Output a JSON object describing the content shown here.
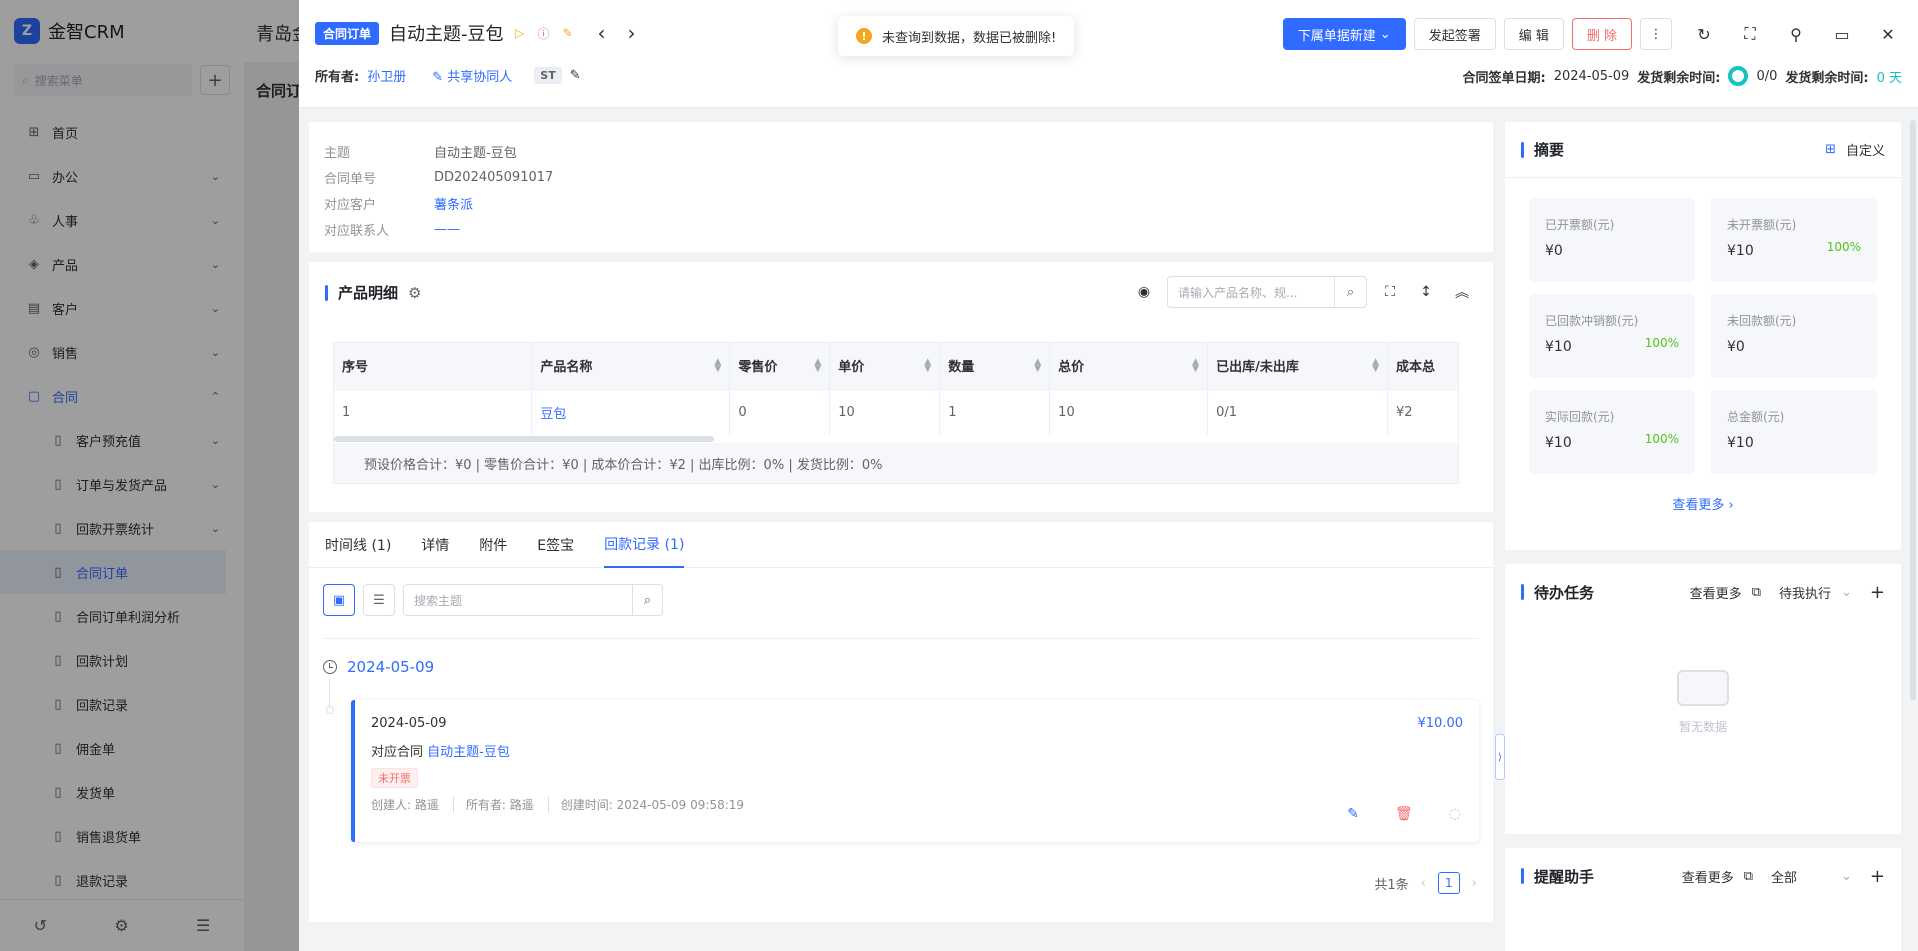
{
  "app": {
    "name": "金智CRM",
    "company": "青岛金",
    "bg_tab": "合同订",
    "search_placeholder": "搜索菜单",
    "menu": [
      {
        "label": "首页",
        "icon": "home-icon",
        "glyph": "⊞",
        "chev": ""
      },
      {
        "label": "办公",
        "icon": "office-icon",
        "glyph": "▭",
        "chev": "⌄"
      },
      {
        "label": "人事",
        "icon": "people-icon",
        "glyph": "♧",
        "chev": "⌄"
      },
      {
        "label": "产品",
        "icon": "product-icon",
        "glyph": "◈",
        "chev": "⌄"
      },
      {
        "label": "客户",
        "icon": "customer-icon",
        "glyph": "▤",
        "chev": "⌄"
      },
      {
        "label": "销售",
        "icon": "sales-icon",
        "glyph": "◎",
        "chev": "⌄"
      },
      {
        "label": "合同",
        "icon": "contract-icon",
        "glyph": "▢",
        "chev": "⌃"
      }
    ],
    "submenu": [
      {
        "label": "客户预充值",
        "chev": "⌄"
      },
      {
        "label": "订单与发货产品",
        "chev": "⌄"
      },
      {
        "label": "回款开票统计",
        "chev": "⌄"
      },
      {
        "label": "合同订单",
        "chev": ""
      },
      {
        "label": "合同订单利润分析",
        "chev": ""
      },
      {
        "label": "回款计划",
        "chev": ""
      },
      {
        "label": "回款记录",
        "chev": ""
      },
      {
        "label": "佣金单",
        "chev": ""
      },
      {
        "label": "发货单",
        "chev": ""
      },
      {
        "label": "销售退货单",
        "chev": ""
      },
      {
        "label": "退款记录",
        "chev": ""
      }
    ]
  },
  "toast": {
    "message": "未查询到数据，数据已被删除!"
  },
  "header": {
    "type_badge": "合同订单",
    "title": "自动主题-豆包",
    "owner_label": "所有者:",
    "owner_name": "孙卫册",
    "share_label": "共享协同人",
    "st_tag": "ST",
    "actions": {
      "new_sub": "下属单据新建",
      "sign": "发起签署",
      "edit": "编 辑",
      "delete": "删 除"
    },
    "sign_date_label": "合同签单日期:",
    "sign_date": "2024-05-09",
    "ship_remain_label": "发货剩余时间:",
    "ship_ratio": "0/0",
    "ship_remain_label2": "发货剩余时间:",
    "ship_days": "0 天"
  },
  "basic": {
    "fields": [
      {
        "label": "主题",
        "value": "自动主题-豆包",
        "link": false
      },
      {
        "label": "合同单号",
        "value": "DD202405091017",
        "link": false
      },
      {
        "label": "对应客户",
        "value": "薯条派",
        "link": true
      },
      {
        "label": "对应联系人",
        "value": "——",
        "link": true
      }
    ]
  },
  "products": {
    "title": "产品明细",
    "search_placeholder": "请输入产品名称、规...",
    "columns": [
      "序号",
      "产品名称",
      "零售价",
      "单价",
      "数量",
      "总价",
      "已出库/未出库",
      "成本总"
    ],
    "rows": [
      [
        "1",
        "豆包",
        "0",
        "10",
        "1",
        "10",
        "0/1",
        "¥2"
      ]
    ],
    "summary": "预设价格合计：¥0 |    零售价合计：¥0 |    成本价合计：¥2 |    出库比例：0% |    发货比例：0%"
  },
  "records": {
    "tabs": [
      "时间线 (1)",
      "详情",
      "附件",
      "E签宝",
      "回款记录 (1)"
    ],
    "active_tab": 4,
    "search_placeholder": "搜索主题",
    "group_date": "2024-05-09",
    "card": {
      "date": "2024-05-09",
      "amount": "¥10.00",
      "contract_label": "对应合同",
      "contract_link": "自动主题-豆包",
      "status": "未开票",
      "creator": "创建人: 路遥",
      "owner": "所有者: 路遥",
      "created_at": "创建时间: 2024-05-09 09:58:19"
    },
    "pager": {
      "total": "共1条",
      "page": "1"
    }
  },
  "summary_panel": {
    "title": "摘要",
    "customize": "自定义",
    "stats": [
      {
        "label": "已开票额(元)",
        "value": "¥0",
        "pct": ""
      },
      {
        "label": "未开票额(元)",
        "value": "¥10",
        "pct": "100%"
      },
      {
        "label": "已回款冲销额(元)",
        "value": "¥10",
        "pct": "100%"
      },
      {
        "label": "未回款额(元)",
        "value": "¥0",
        "pct": ""
      },
      {
        "label": "实际回款(元)",
        "value": "¥10",
        "pct": "100%"
      },
      {
        "label": "总金额(元)",
        "value": "¥10",
        "pct": ""
      }
    ],
    "see_more": "查看更多"
  },
  "todo_panel": {
    "title": "待办任务",
    "see_more": "查看更多",
    "filter": "待我执行",
    "empty": "暂无数据"
  },
  "remind_panel": {
    "title": "提醒助手",
    "see_more": "查看更多",
    "filter": "全部"
  },
  "colors": {
    "accent": "#2f6bff",
    "danger": "#f56c6c",
    "success": "#52c41a",
    "teal": "#13c2c2",
    "warning": "#f5a623"
  }
}
